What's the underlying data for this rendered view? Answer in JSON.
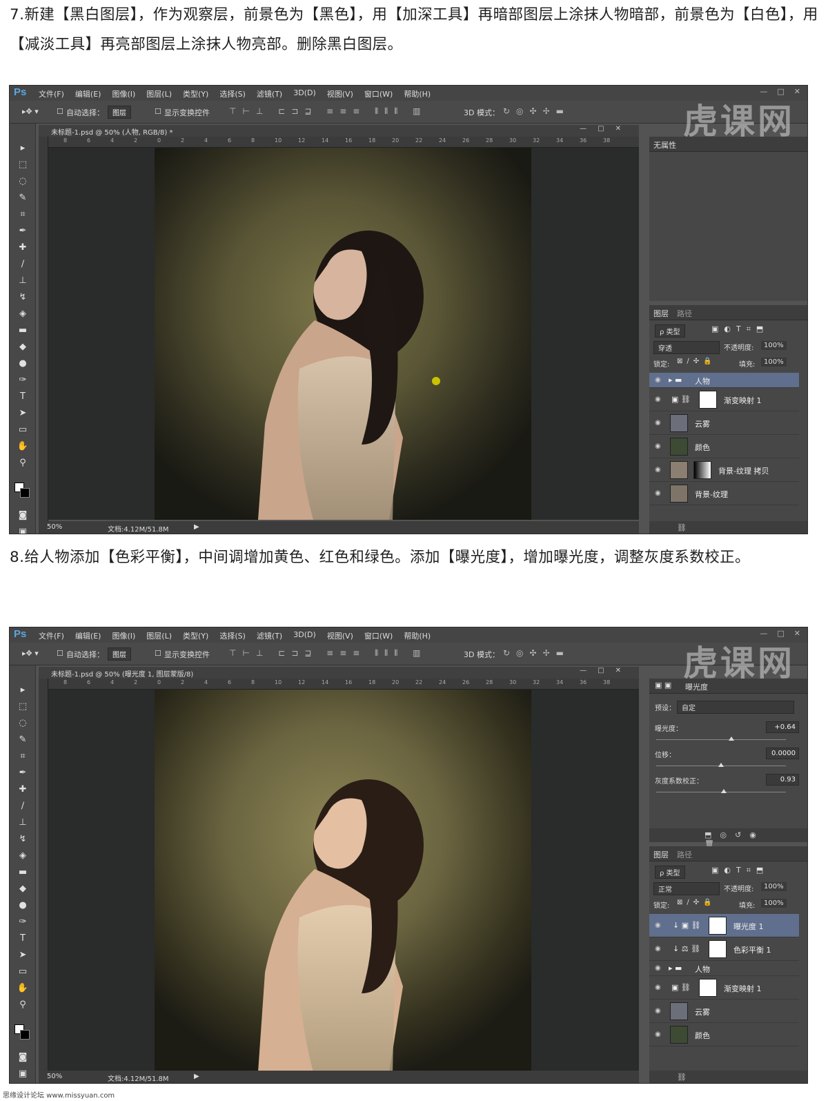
{
  "step7": {
    "text": "7.新建【黑白图层】，作为观察层，前景色为【黑色】，用【加深工具】再暗部图层上涂抹人物暗部，前景色为【白色】，用【减淡工具】再亮部图层上涂抹人物亮部。删除黑白图层。"
  },
  "step8": {
    "text": "8.给人物添加【色彩平衡】，中间调增加黄色、红色和绿色。添加【曝光度】，增加曝光度，调整灰度系数校正。"
  },
  "app": {
    "logo": "Ps",
    "menus": [
      "文件(F)",
      "编辑(E)",
      "图像(I)",
      "图层(L)",
      "类型(Y)",
      "选择(S)",
      "滤镜(T)",
      "3D(D)",
      "视图(V)",
      "窗口(W)",
      "帮助(H)"
    ],
    "watermark": "虎课网",
    "options": {
      "auto_select": "自动选择：",
      "auto_select_value": "图层",
      "show_transform": "显示变换控件",
      "mode3d": "3D 模式："
    }
  },
  "shot1": {
    "doc_title": "未标题-1.psd @ 50% (人物, RGB/8) *",
    "zoom": "50%",
    "doc_size": "文档:4.12M/51.8M",
    "properties_title": "无属性",
    "layers_tabs": [
      "图层",
      "路径"
    ],
    "filter_kind": "ρ 类型",
    "blend_mode": "穿透",
    "opacity_label": "不透明度:",
    "opacity_value": "100%",
    "lock_label": "锁定:",
    "fill_label": "填充:",
    "fill_value": "100%",
    "layers": [
      {
        "name": "人物"
      },
      {
        "name": "渐变映射 1"
      },
      {
        "name": "云雾"
      },
      {
        "name": "颜色"
      },
      {
        "name": "背景-纹理 拷贝"
      },
      {
        "name": "背景-纹理"
      }
    ]
  },
  "shot2": {
    "doc_title": "未标题-1.psd @ 50% (曝光度 1, 图层蒙版/8)",
    "zoom": "50%",
    "doc_size": "文档:4.12M/51.8M",
    "properties_title": "曝光度",
    "preset_label": "预设：",
    "preset_value": "自定",
    "exposure_label": "曝光度：",
    "exposure_value": "+0.64",
    "exposure_level": 0.58,
    "offset_label": "位移：",
    "offset_value": "0.0000",
    "offset_level": 0.5,
    "gamma_label": "灰度系数校正：",
    "gamma_value": "0.93",
    "gamma_level": 0.52,
    "layers_tabs": [
      "图层",
      "路径"
    ],
    "filter_kind": "ρ 类型",
    "blend_mode": "正常",
    "opacity_label": "不透明度:",
    "opacity_value": "100%",
    "lock_label": "锁定:",
    "fill_label": "填充:",
    "fill_value": "100%",
    "layers": [
      {
        "name": "曝光度 1"
      },
      {
        "name": "色彩平衡 1"
      },
      {
        "name": "人物"
      },
      {
        "name": "渐变映射 1"
      },
      {
        "name": "云雾"
      },
      {
        "name": "颜色"
      }
    ]
  },
  "footer": {
    "site": "思缘设计论坛 www.missyuan.com"
  },
  "colors": {
    "ps_blue": "#5aa6e0",
    "selected_layer": "#5f6f8d",
    "panel": "#474747"
  }
}
